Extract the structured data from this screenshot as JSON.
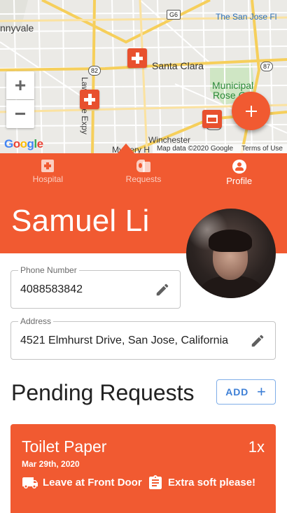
{
  "map": {
    "labels": {
      "sunnyvale": "nnyvale",
      "san_jose_fl": "The San Jose Fl",
      "santa_clara": "Santa Clara",
      "municipal": "Municipal",
      "rose_garden": "Rose Gar",
      "winchester": "Winchester",
      "mystery": "Mystery H",
      "lawrence": "Lawrence Expy"
    },
    "route_shields": {
      "g6": "G6",
      "r82": "82",
      "r87": "87",
      "r280": "280"
    },
    "zoom_in": "+",
    "zoom_out": "−",
    "google": [
      "G",
      "o",
      "o",
      "g",
      "l",
      "e"
    ],
    "footer": {
      "data": "Map data ©2020 Google",
      "terms": "Terms of Use"
    },
    "icons": [
      "hospital-pin-icon",
      "store-pin-icon"
    ]
  },
  "fab": {
    "label": "+"
  },
  "tabs": [
    {
      "label": "Hospital",
      "icon": "hospital-icon"
    },
    {
      "label": "Requests",
      "icon": "toilet-roll-icon"
    },
    {
      "label": "Profile",
      "icon": "account-circle-icon"
    }
  ],
  "profile": {
    "name": "Samuel Li",
    "phone": {
      "label": "Phone Number",
      "value": "4088583842"
    },
    "address": {
      "label": "Address",
      "value": "4521 Elmhurst Drive, San Jose, California"
    }
  },
  "pending": {
    "title": "Pending Requests",
    "add_label": "ADD",
    "requests": [
      {
        "item": "Toilet Paper",
        "quantity": "1x",
        "date": "Mar 29th, 2020",
        "delivery": "Leave at Front Door",
        "note": "Extra soft please!"
      }
    ]
  },
  "colors": {
    "accent": "#f15a31",
    "button_blue": "#3d7fd6"
  }
}
